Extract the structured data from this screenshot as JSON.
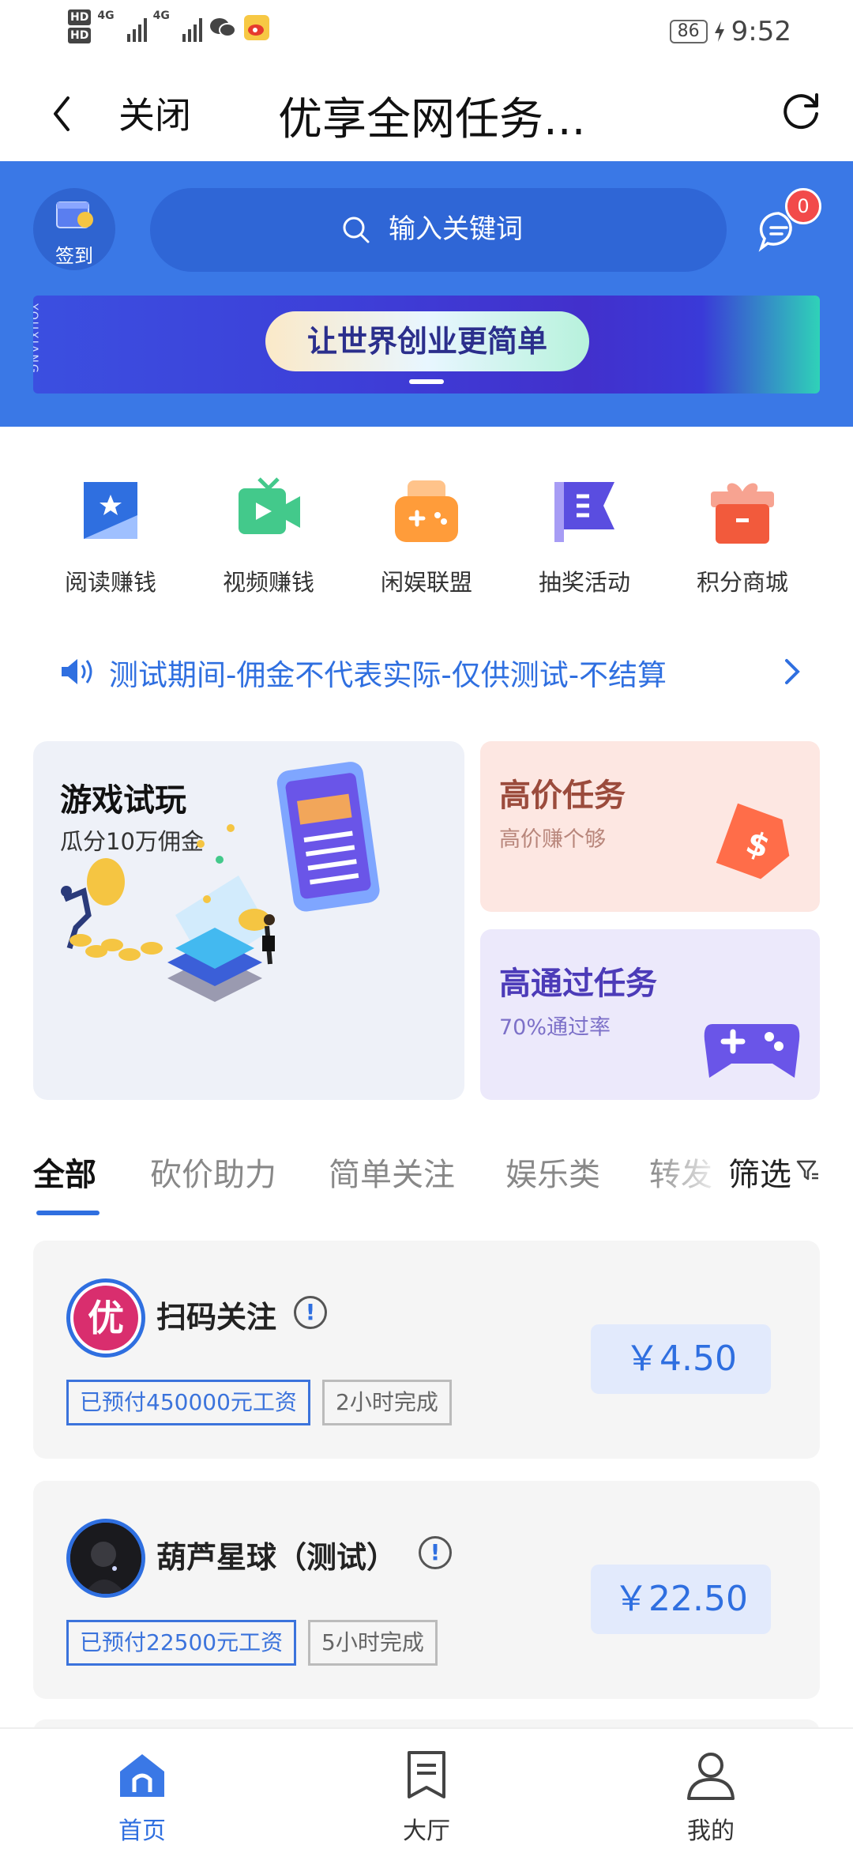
{
  "status_bar": {
    "hd1": "HD",
    "hd2": "HD",
    "net1": "4G",
    "net2": "4G",
    "battery": "86",
    "time": "9:52"
  },
  "title_bar": {
    "close_label": "关闭",
    "title": "优享全网任务..."
  },
  "header": {
    "signin_label": "签到",
    "search_placeholder": "输入关键词",
    "message_badge": "0",
    "banner_side_text": "YOUXIANG",
    "banner_slogan": "让世界创业更简单"
  },
  "categories": [
    {
      "label": "阅读赚钱",
      "icon": "star-flag-icon",
      "color": "#2f6fe0"
    },
    {
      "label": "视频赚钱",
      "icon": "video-icon",
      "color": "#43c98b"
    },
    {
      "label": "闲娱联盟",
      "icon": "gamepad-icon",
      "color": "#ff9c3a"
    },
    {
      "label": "抽奖活动",
      "icon": "flag-list-icon",
      "color": "#5a4de0"
    },
    {
      "label": "积分商城",
      "icon": "gift-icon",
      "color": "#f25a3c"
    }
  ],
  "notice": {
    "text": "测试期间-佣金不代表实际-仅供测试-不结算"
  },
  "promo_cards": {
    "game": {
      "title": "游戏试玩",
      "subtitle": "瓜分10万佣金"
    },
    "high_price": {
      "title": "高价任务",
      "subtitle": "高价赚个够"
    },
    "high_pass": {
      "title": "高通过任务",
      "subtitle": "70%通过率"
    }
  },
  "tabs": {
    "items": [
      "全部",
      "砍价助力",
      "简单关注",
      "娱乐类",
      "转发"
    ],
    "active": "全部",
    "filter_label": "筛选"
  },
  "tasks": [
    {
      "name": "扫码关注",
      "prepaid": "已预付450000元工资",
      "duration": "2小时完成",
      "price": "￥4.50",
      "avatar_char": "优"
    },
    {
      "name": "葫芦星球（测试）",
      "prepaid": "已预付22500元工资",
      "duration": "5小时完成",
      "price": "￥22.50"
    }
  ],
  "bottom_nav": [
    {
      "label": "首页",
      "icon": "home-icon"
    },
    {
      "label": "大厅",
      "icon": "hall-icon"
    },
    {
      "label": "我的",
      "icon": "profile-icon"
    }
  ],
  "colors": {
    "primary": "#3a78e6",
    "accent": "#2f6fe0",
    "badge": "#f24a4a"
  }
}
